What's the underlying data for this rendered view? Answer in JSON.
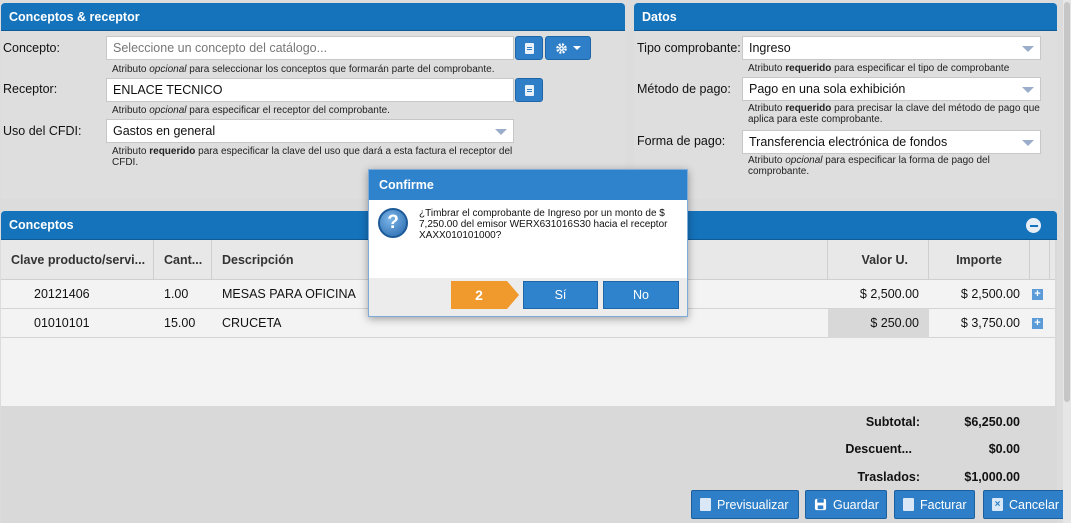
{
  "left_panel": {
    "title": "Conceptos & receptor",
    "concepto_label": "Concepto:",
    "concepto_placeholder": "Seleccione un concepto del catálogo...",
    "concepto_hint_a": "Atributo ",
    "concepto_hint_b": "opcional",
    "concepto_hint_c": " para seleccionar los conceptos que formarán parte del comprobante.",
    "receptor_label": "Receptor:",
    "receptor_value": "ENLACE TECNICO",
    "receptor_hint_a": "Atributo ",
    "receptor_hint_b": "opcional",
    "receptor_hint_c": " para especificar el receptor del comprobante.",
    "uso_label": "Uso del CFDI:",
    "uso_value": "Gastos en general",
    "uso_hint_a": "Atributo ",
    "uso_hint_b": "requerido",
    "uso_hint_c": " para especificar la clave del uso que dará a esta factura el receptor del CFDI."
  },
  "right_panel": {
    "title": "Datos",
    "tipo_label": "Tipo comprobante:",
    "tipo_value": "Ingreso",
    "tipo_hint_a": "Atributo ",
    "tipo_hint_b": "requerido",
    "tipo_hint_c": " para especificar el tipo de comprobante",
    "metodo_label": "Método de pago:",
    "metodo_value": "Pago en una sola exhibición",
    "metodo_hint_a": "Atributo ",
    "metodo_hint_b": "requerido",
    "metodo_hint_c": " para precisar la clave del método de pago que aplica para este comprobante.",
    "forma_label": "Forma de pago:",
    "forma_value": "Transferencia electrónica de fondos",
    "forma_hint_a": "Atributo ",
    "forma_hint_b": "opcional",
    "forma_hint_c": " para especificar la forma de pago del comprobante."
  },
  "conceptos": {
    "title": "Conceptos",
    "columns": {
      "clave": "Clave producto/servi...",
      "cant": "Cant...",
      "descripcion": "Descripción",
      "valor": "Valor U.",
      "importe": "Importe"
    },
    "rows": [
      {
        "clave": "20121406",
        "cant": "1.00",
        "descripcion": "MESAS PARA OFICINA",
        "valor": "$ 2,500.00",
        "importe": "$ 2,500.00"
      },
      {
        "clave": "01010101",
        "cant": "15.00",
        "descripcion": "CRUCETA",
        "valor": "$ 250.00",
        "importe": "$ 3,750.00"
      }
    ]
  },
  "totals": {
    "subtotal_label": "Subtotal:",
    "subtotal_value": "$6,250.00",
    "descuento_label": "Descuent...",
    "descuento_value": "$0.00",
    "traslados_label": "Traslados:",
    "traslados_value": "$1,000.00"
  },
  "footer": {
    "preview": "Previsualizar",
    "guardar": "Guardar",
    "facturar": "Facturar",
    "cancelar": "Cancelar"
  },
  "dialog": {
    "title": "Confirme",
    "icon": "?",
    "message": "¿Timbrar el comprobante de Ingreso por un monto de $ 7,250.00 del emisor WERX631016S30 hacia el receptor XAXX010101000?",
    "step": "2",
    "yes": "Sí",
    "no": "No"
  },
  "icons": {
    "collapse": "minus-circle-icon",
    "add": "add-document-icon",
    "gear": "gear-icon"
  },
  "colors": {
    "header_blue": "#1573bb",
    "button_blue": "#2f7fc8",
    "step_orange": "#f0992d"
  }
}
